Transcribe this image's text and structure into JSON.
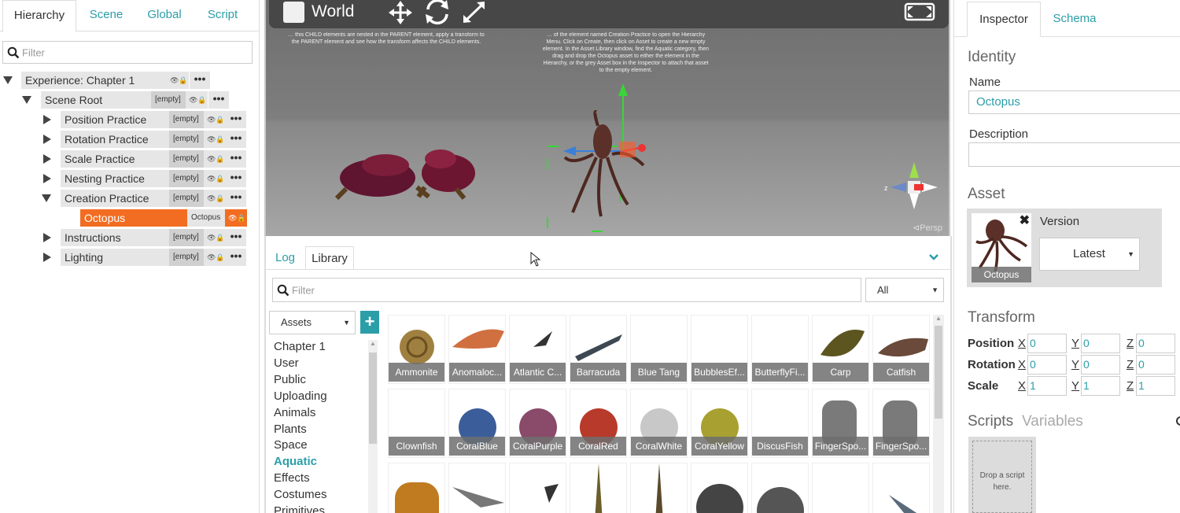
{
  "left": {
    "tabs": [
      "Hierarchy",
      "Scene",
      "Global",
      "Script"
    ],
    "filter_placeholder": "Filter",
    "root": {
      "label": "Experience: Chapter 1"
    },
    "scene_root": {
      "label": "Scene Root",
      "tag": "[empty]"
    },
    "items": [
      {
        "label": "Position Practice",
        "tag": "[empty]"
      },
      {
        "label": "Rotation Practice",
        "tag": "[empty]"
      },
      {
        "label": "Scale Practice",
        "tag": "[empty]"
      },
      {
        "label": "Nesting Practice",
        "tag": "[empty]"
      },
      {
        "label": "Creation Practice",
        "tag": "[empty]"
      },
      {
        "label": "Octopus",
        "tag": "Octopus"
      },
      {
        "label": "Instructions",
        "tag": "[empty]"
      },
      {
        "label": "Lighting",
        "tag": "[empty]"
      }
    ]
  },
  "viewport": {
    "space_label": "World",
    "note_left": "… this CHILD elements are nested in the PARENT element, apply a transform to the PARENT element and see how the transform affects the CHILD elements.",
    "note_right": "… of the element named Creation Practice to open the Hierarchy Menu. Click on Create, then click on Asset to create a new empty element. In the Asset Library window, find the Aquatic category, then drag and drop the Octopus asset to either the element in the Hierarchy, or the grey Asset box in the Inspector to attach that asset to the empty element.",
    "persp_label": "⊲Persp"
  },
  "bottom": {
    "tabs": [
      "Log",
      "Library"
    ],
    "filter_placeholder": "Filter",
    "type_select": "All",
    "source_select": "Assets",
    "categories": [
      "Chapter 1",
      "User",
      "Public",
      "Uploading",
      "Animals",
      "Plants",
      "Space",
      "Aquatic",
      "Effects",
      "Costumes",
      "Primitives"
    ],
    "active_category": "Aquatic",
    "assets_row1": [
      "Ammonite",
      "Anomaloc...",
      "Atlantic C...",
      "Barracuda",
      "Blue Tang",
      "BubblesEf...",
      "ButterflyFi...",
      "Carp",
      "Catfish"
    ],
    "assets_row2": [
      "Clownfish",
      "CoralBlue",
      "CoralPurple",
      "CoralRed",
      "CoralWhite",
      "CoralYellow",
      "DiscusFish",
      "FingerSpo...",
      "FingerSpo..."
    ],
    "assets_row3": [
      "",
      "",
      "",
      "",
      "",
      "",
      "",
      "",
      ""
    ]
  },
  "inspector": {
    "tabs": [
      "Inspector",
      "Schema"
    ],
    "identity_heading": "Identity",
    "name_label": "Name",
    "name_value": "Octopus",
    "description_label": "Description",
    "description_value": "",
    "asset_heading": "Asset",
    "asset_name": "Octopus",
    "version_label": "Version",
    "version_value": "Latest",
    "transform_heading": "Transform",
    "axes": [
      "X",
      "Y",
      "Z"
    ],
    "transform": [
      {
        "label": "Position",
        "values": [
          "0",
          "0",
          "0"
        ]
      },
      {
        "label": "Rotation",
        "values": [
          "0",
          "0",
          "0"
        ]
      },
      {
        "label": "Scale",
        "values": [
          "1",
          "1",
          "1"
        ]
      }
    ],
    "scripts_tab": "Scripts",
    "variables_tab": "Variables",
    "drop_hint": "Drop a script here."
  },
  "colors": {
    "accent": "#2b9ea8",
    "selected": "#f26d21"
  }
}
